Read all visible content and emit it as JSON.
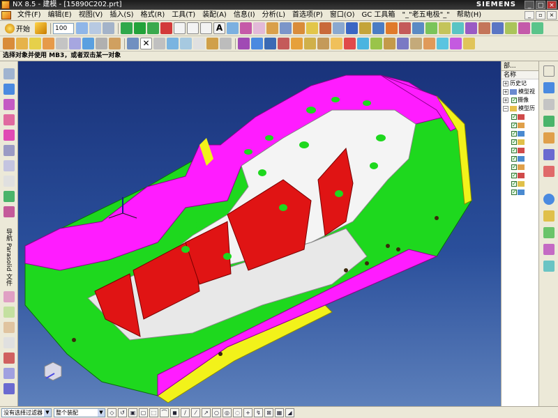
{
  "window": {
    "title": "NX 8.5 - 建模 - [15890C202.prt]",
    "brand": "SIEMENS",
    "minimize": "_",
    "maximize": "□",
    "close": "×"
  },
  "menu": {
    "items": [
      "文件(F)",
      "编辑(E)",
      "视图(V)",
      "插入(S)",
      "格式(R)",
      "工具(T)",
      "装配(A)",
      "信息(I)",
      "分析(L)",
      "首选项(P)",
      "窗口(O)",
      "GC 工具箱",
      "\"_\"老五电极\"_\"",
      "帮助(H)"
    ]
  },
  "toolbar": {
    "start_label": "开始",
    "zoom_value": "100"
  },
  "prompt": {
    "text": "选择对象并使用 MB3，或者双击某一对象"
  },
  "left_bar": {
    "vertical_text": "导航 Parasolid 文件"
  },
  "navigator": {
    "header": "部...",
    "column_header": "名称",
    "nodes": [
      {
        "label": "历史记",
        "type": "folder"
      },
      {
        "label": "模型视",
        "type": "folder"
      },
      {
        "label": "摄像",
        "type": "folder"
      },
      {
        "label": "模型历",
        "type": "folder"
      }
    ],
    "feature_count": 10
  },
  "bottom_bar": {
    "filter_label": "没有选择过滤器",
    "assembly_label": "整个装配"
  },
  "colors": {
    "face_green": "#1ed81e",
    "face_magenta": "#ff1cff",
    "face_yellow": "#f2f21a",
    "face_red": "#e01414",
    "face_white": "#f4f4f4",
    "background_top": "#19327a"
  }
}
